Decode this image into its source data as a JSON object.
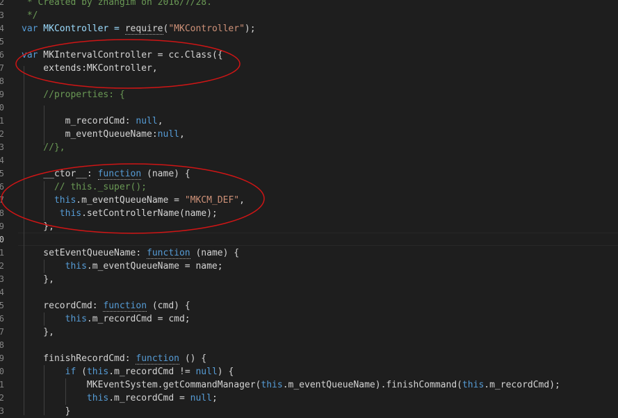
{
  "editor": {
    "line_number_digits": [
      "2",
      "3",
      "4",
      "5",
      "6",
      "7",
      "8",
      "9",
      "0",
      "1",
      "2",
      "3",
      "4",
      "5",
      "6",
      "7",
      "8",
      "9",
      "0",
      "1",
      "2",
      "3",
      "4",
      "5",
      "6",
      "7",
      "8",
      "9",
      "0",
      "1",
      "2",
      "3"
    ]
  },
  "code": {
    "l1": " * Created by zhangim on 2016/7/28.",
    "l2": " */",
    "l3_kw": "var",
    "l3_name": " MKController = ",
    "l3_fn": "require",
    "l3_open": "(",
    "l3_str": "\"MKController\"",
    "l3_close": ");",
    "l5_kw": "var",
    "l5_name": " MKIntervalController = ",
    "l5_rest": "cc.Class({",
    "l6": "    extends:MKController,",
    "l8": "    //properties: {",
    "l10_a": "        m_recordCmd: ",
    "l10_b": "null",
    "l10_c": ",",
    "l11_a": "        m_eventQueueName:",
    "l11_b": "null",
    "l11_c": ",",
    "l12": "    //},",
    "l14_a": "    __ctor__: ",
    "l14_kw": "function",
    "l14_b": " (name) {",
    "l15": "      // this._super();",
    "l16_kw": "      this",
    "l16_a": ".m_eventQueueName = ",
    "l16_str": "\"MKCM_DEF\"",
    "l16_b": ",",
    "l17_kw": "       this",
    "l17_a": ".setControllerName(name);",
    "l18": "    },",
    "l20_a": "    setEventQueueName: ",
    "l20_kw": "function",
    "l20_b": " (name) {",
    "l21_kw": "        this",
    "l21_a": ".m_eventQueueName = name;",
    "l22": "    },",
    "l24_a": "    recordCmd: ",
    "l24_kw": "function",
    "l24_b": " (cmd) {",
    "l25_kw": "        this",
    "l25_a": ".m_recordCmd = cmd;",
    "l26": "    },",
    "l28_a": "    finishRecordCmd: ",
    "l28_kw": "function",
    "l28_b": " () {",
    "l29_if": "        if",
    "l29_a": " (",
    "l29_this": "this",
    "l29_b": ".m_recordCmd != ",
    "l29_null": "null",
    "l29_c": ") {",
    "l30_a": "            MKEventSystem.getCommandManager(",
    "l30_this1": "this",
    "l30_b": ".m_eventQueueName).finishCommand(",
    "l30_this2": "this",
    "l30_c": ".m_recordCmd);",
    "l31_this": "            this",
    "l31_a": ".m_recordCmd = ",
    "l31_null": "null",
    "l31_b": ";",
    "l32": "        }"
  },
  "colors": {
    "background": "#1e1e1e",
    "keyword": "#569cd6",
    "string": "#ce9178",
    "comment": "#6a9955",
    "annotation_ellipse": "#d01515"
  }
}
